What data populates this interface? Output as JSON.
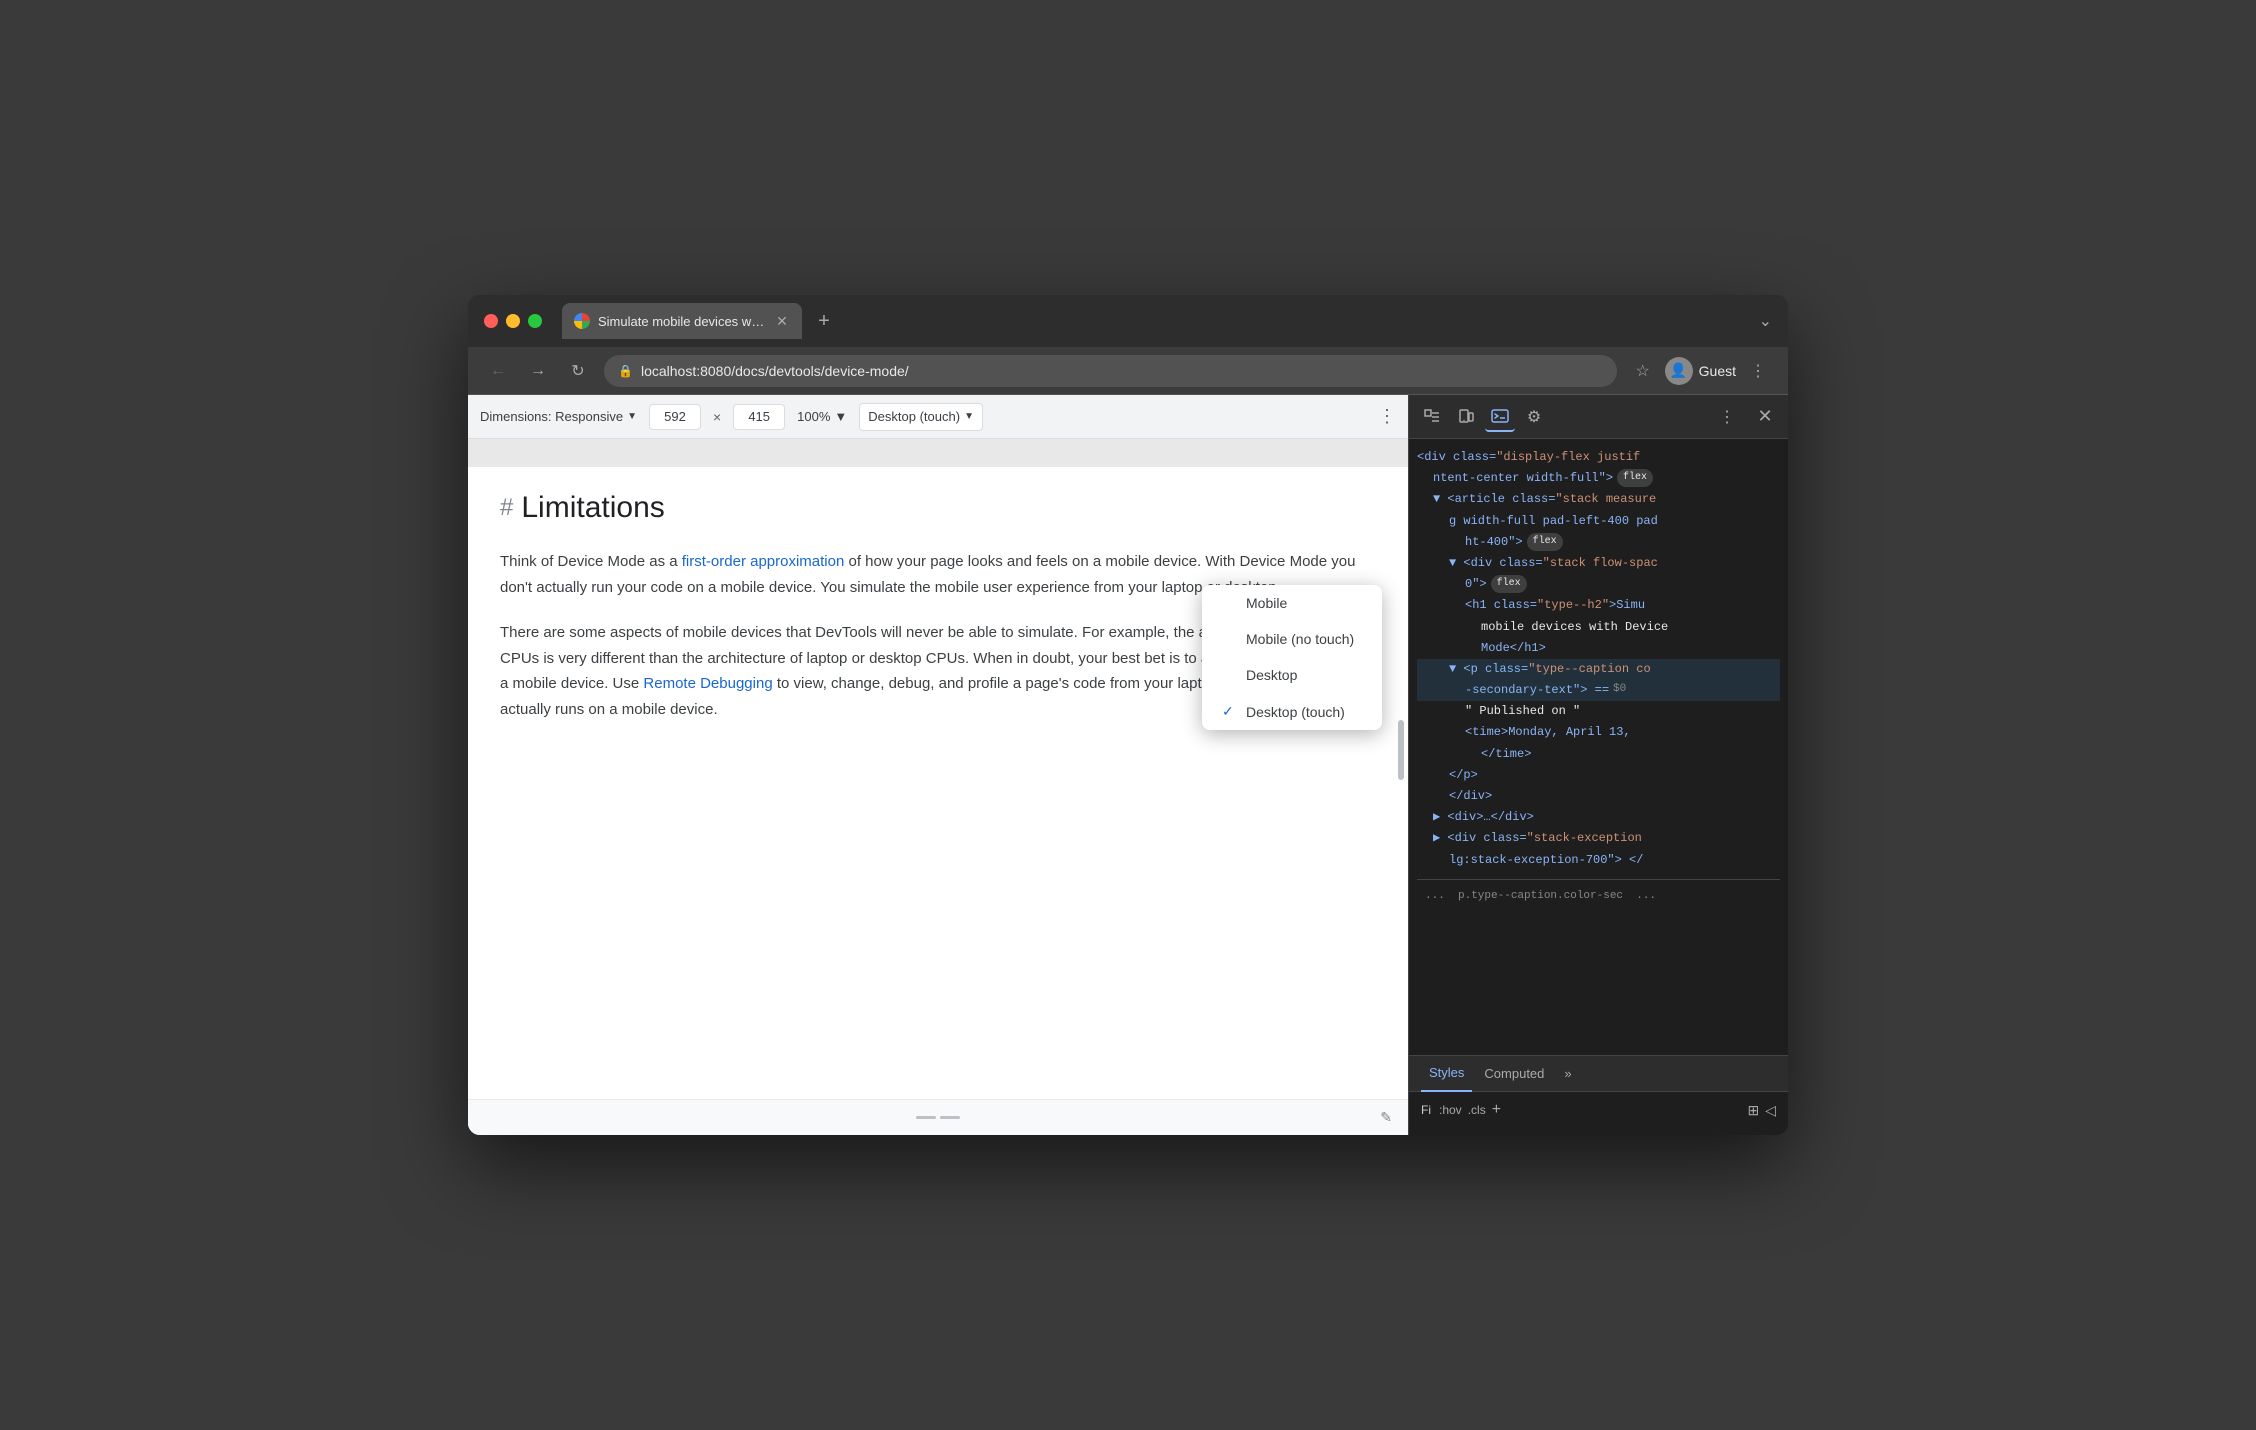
{
  "browser": {
    "title": "Simulate mobile devices with D",
    "tab_title": "Simulate mobile devices with D",
    "url": "localhost:8080/docs/devtools/device-mode/",
    "profile": "Guest"
  },
  "device_toolbar": {
    "dimensions_label": "Dimensions: Responsive",
    "width_value": "592",
    "height_value": "415",
    "zoom_label": "100%",
    "device_label": "Desktop (touch)"
  },
  "dropdown": {
    "items": [
      {
        "label": "Mobile",
        "checked": false
      },
      {
        "label": "Mobile (no touch)",
        "checked": false
      },
      {
        "label": "Desktop",
        "checked": false
      },
      {
        "label": "Desktop (touch)",
        "checked": true
      }
    ]
  },
  "page": {
    "heading_hash": "#",
    "heading": "Limitations",
    "para1_start": "Think of Device Mode as a ",
    "para1_link": "first-order approximation",
    "para1_rest": " of how your page looks and feels on a mobile device. With Device Mode you don't actually run your code on a mobile device. You simulate the mobile user experience from your laptop or desktop.",
    "para2_start": "There are some aspects of mobile devices that DevTools will never be able to simulate. For example, the architecture of mobile CPUs is very different than the architecture of laptop or desktop CPUs. When in doubt, your best bet is to actually run your page on a mobile device. Use ",
    "para2_link": "Remote Debugging",
    "para2_rest": " to view, change, debug, and profile a page's code from your laptop or desktop while it actually runs on a mobile device."
  },
  "devtools": {
    "html_lines": [
      {
        "indent": 0,
        "content": "<div class=\"display-flex justif",
        "type": "tag"
      },
      {
        "indent": 1,
        "content": "ntent-center width-full\">",
        "type": "tag",
        "badge": "flex"
      },
      {
        "indent": 1,
        "content": "<article class=\"stack measure",
        "type": "tag"
      },
      {
        "indent": 2,
        "content": "g width-full pad-left-400 pad",
        "type": "tag"
      },
      {
        "indent": 3,
        "content": "ht-400\">",
        "type": "tag",
        "badge": "flex"
      },
      {
        "indent": 2,
        "content": "<div class=\"stack flow-spac",
        "type": "tag"
      },
      {
        "indent": 3,
        "content": "0\">",
        "type": "tag",
        "badge": "flex"
      },
      {
        "indent": 3,
        "content": "<h1 class=\"type--h2\">Simu",
        "type": "tag"
      },
      {
        "indent": 4,
        "content": "mobile devices with Device",
        "type": "text"
      },
      {
        "indent": 4,
        "content": "Mode</h1>",
        "type": "tag"
      },
      {
        "indent": 2,
        "content": "<p class=\"type--caption co",
        "type": "tag",
        "selected": true
      },
      {
        "indent": 3,
        "content": "-secondary-text\"> == $0",
        "type": "tag",
        "dollar": true
      },
      {
        "indent": 3,
        "content": "\" Published on \"",
        "type": "text"
      },
      {
        "indent": 3,
        "content": "<time>Monday, April 13,",
        "type": "tag"
      },
      {
        "indent": 4,
        "content": "</time>",
        "type": "tag"
      },
      {
        "indent": 2,
        "content": "</p>",
        "type": "tag"
      },
      {
        "indent": 2,
        "content": "</div>",
        "type": "tag"
      },
      {
        "indent": 1,
        "content": "▶ <div>…</div>",
        "type": "tag"
      },
      {
        "indent": 1,
        "content": "▶ <div class=\"stack-exception",
        "type": "tag"
      },
      {
        "indent": 2,
        "content": "lg:stack-exception-700\"> </",
        "type": "tag"
      },
      {
        "indent": 0,
        "content": "...  p.type--caption.color-sec  ...",
        "type": "breadcrumb"
      }
    ],
    "bottom_tabs": [
      "Styles",
      "Computed",
      "»"
    ],
    "filter_items": [
      "Fi",
      ":hov",
      ".cls",
      "+"
    ],
    "active_tab": "Styles"
  }
}
